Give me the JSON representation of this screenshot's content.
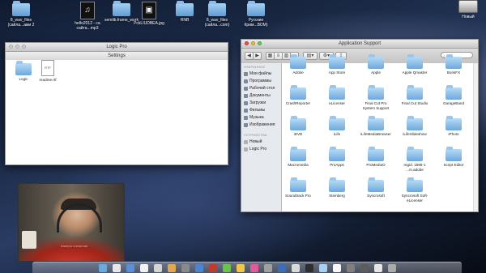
{
  "desktop": {
    "icons": [
      {
        "label": "8_wav_files (сайла...ами 2",
        "kind": "folder"
      },
      {
        "label": "hello2012 - са сайта...mp3",
        "kind": "audio"
      },
      {
        "label": "semlib.frame_work",
        "kind": "folder"
      },
      {
        "label": "PckLIUDBEA.jpg",
        "kind": "image"
      },
      {
        "label": "RNB",
        "kind": "folder"
      },
      {
        "label": "8_wav_files (сайла...com)",
        "kind": "folder"
      },
      {
        "label": "Русские Крим...ВОМ)",
        "kind": "folder"
      },
      {
        "label": "Новый",
        "kind": "drive"
      }
    ]
  },
  "logic_window": {
    "back_title": "Logic Pro",
    "title": "Settings",
    "items": [
      {
        "label": "Logic",
        "kind": "folder"
      },
      {
        "label": "readme.rtf",
        "kind": "document",
        "badge": "RTF"
      }
    ]
  },
  "app_support_window": {
    "title": "Application Support",
    "search_icon": "magnifier-icon",
    "sidebar": {
      "favorites_header": "ИЗБРАННОЕ",
      "favorites": [
        "Мои файлы",
        "Программы",
        "Рабочий стол",
        "Документы",
        "Загрузки",
        "Фильмы",
        "Музыка",
        "Изображения"
      ],
      "devices_header": "УСТРОЙСТВА",
      "devices": [
        "Новый",
        "Logic Pro"
      ]
    },
    "folders": [
      "Adobe",
      "App Store",
      "Apple",
      "Apple Qmaster",
      "BorisFX",
      "CrashReporter",
      "eLicenser",
      "Final Cut Pro System Support",
      "Final Cut Studio",
      "GarageBand",
      "iDVD",
      "iLife",
      "iLifeMediaBrowser",
      "iLifeSlideshow",
      "iPhoto",
      "Macromedia",
      "ProApps",
      "ProMediaO",
      "regid. 1986-1 ...m.adobe",
      "Script Editor",
      "Soundtrack Pro",
      "Steinberg",
      "Syncrosoft",
      "Syncrosoft Soft-eLicenser"
    ]
  },
  "webcam": {
    "overlay_text": "Камера слежения"
  },
  "dock": {
    "colors": [
      "#6aa9e0",
      "#e8e8e8",
      "#5a8fd8",
      "#f2f2f2",
      "#d4d4d4",
      "#e0a94c",
      "#8a8a8a",
      "#4b84d1",
      "#c13a2e",
      "#6cc24a",
      "#f2c744",
      "#e15a9a",
      "#a0a0a0",
      "#3b6db8",
      "#d9d9d9",
      "#2e2e2e",
      "#a8d0f2",
      "#f7f7f7",
      "#7f7f7f",
      "#5c5c5c",
      "#e6e6e6",
      "#aaaaaa"
    ]
  }
}
